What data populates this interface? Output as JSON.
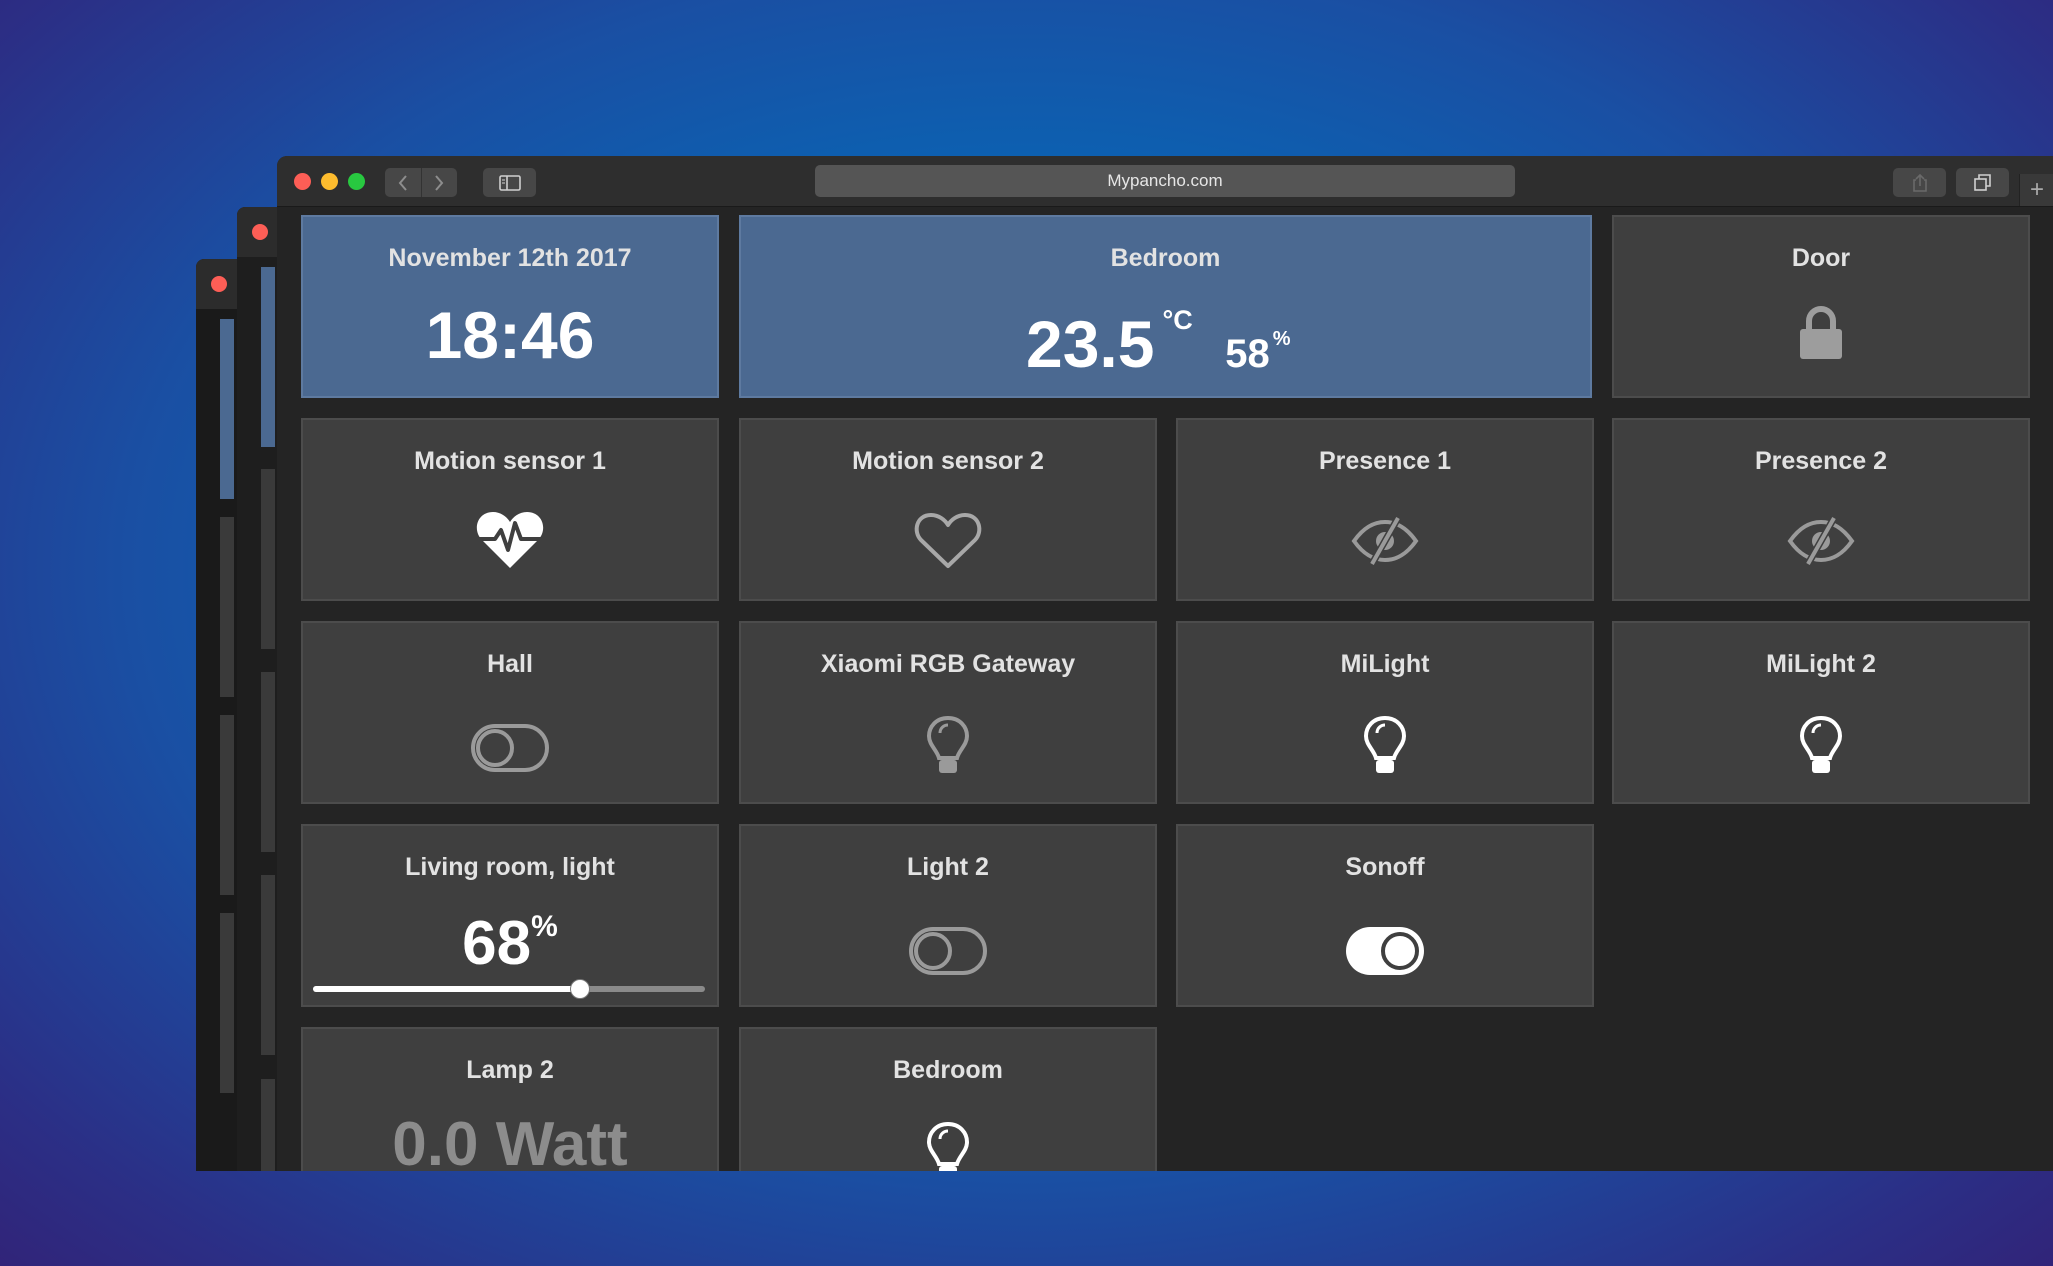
{
  "browser": {
    "url": "Mypancho.com"
  },
  "tiles": {
    "date": {
      "title": "November 12th 2017",
      "time": "18:46"
    },
    "bedroom_climate": {
      "title": "Bedroom",
      "temperature": "23.5",
      "temp_unit": "°C",
      "humidity": "58",
      "humidity_unit": "%"
    },
    "door": {
      "title": "Door",
      "icon": "lock-icon"
    },
    "motion1": {
      "title": "Motion sensor 1",
      "icon": "heartbeat-icon",
      "active": true
    },
    "motion2": {
      "title": "Motion sensor 2",
      "icon": "heart-outline-icon",
      "active": false
    },
    "presence1": {
      "title": "Presence 1",
      "icon": "eye-slash-icon"
    },
    "presence2": {
      "title": "Presence 2",
      "icon": "eye-slash-icon"
    },
    "hall": {
      "title": "Hall",
      "state": "off"
    },
    "xiaomi": {
      "title": "Xiaomi RGB Gateway",
      "state": "off"
    },
    "milight": {
      "title": "MiLight",
      "state": "on"
    },
    "milight2": {
      "title": "MiLight 2",
      "state": "on"
    },
    "living_room": {
      "title": "Living room, light",
      "value": "68",
      "unit": "%",
      "level": 0.68
    },
    "light2": {
      "title": "Light 2",
      "state": "off"
    },
    "sonoff": {
      "title": "Sonoff",
      "state": "on"
    },
    "lamp2": {
      "title": "Lamp 2",
      "value": "0.0 Watt"
    },
    "bedroom_light": {
      "title": "Bedroom",
      "state": "on"
    }
  },
  "colors": {
    "tile": "#3f3f3f",
    "tile_highlight": "#4b6991",
    "background": "#242424"
  }
}
